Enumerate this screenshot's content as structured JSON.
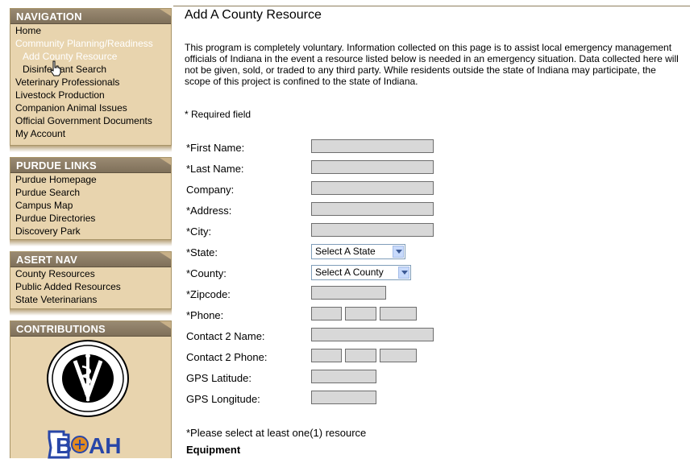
{
  "sidebar": {
    "navigation": {
      "title": "Navigation",
      "items": [
        {
          "label": "Home",
          "active": false,
          "sub": false
        },
        {
          "label": "Community Planning/Readiness",
          "active": true,
          "sub": false
        },
        {
          "label": "Add County Resource",
          "active": true,
          "sub": true
        },
        {
          "label": "Disinfectant Search",
          "active": false,
          "sub": true
        },
        {
          "label": "Veterinary Professionals",
          "active": false,
          "sub": false
        },
        {
          "label": "Livestock Production",
          "active": false,
          "sub": false
        },
        {
          "label": "Companion Animal Issues",
          "active": false,
          "sub": false
        },
        {
          "label": "Official Government Documents",
          "active": false,
          "sub": false
        },
        {
          "label": "My Account",
          "active": false,
          "sub": false
        }
      ]
    },
    "purdue_links": {
      "title": "Purdue Links",
      "items": [
        "Purdue Homepage",
        "Purdue Search",
        "Campus Map",
        "Purdue Directories",
        "Discovery Park"
      ]
    },
    "asert_nav": {
      "title": "ASERT Nav",
      "items": [
        "County Resources",
        "Public Added Resources",
        "State Veterinarians"
      ]
    },
    "contributions": {
      "title": "Contributions",
      "seal_text": "Veterinary Medicine Purdue",
      "boah_text": "BOAH"
    }
  },
  "main": {
    "title": "Add A County Resource",
    "intro": "This program is completely voluntary. Information collected on this page is to assist local emergency management officials of Indiana in the event a resource listed below is needed in an emergency situation. Data collected here will not be given, sold, or traded to any third party. While residents outside the state of Indiana may participate, the scope of this project is confined to the state of Indiana.",
    "required_note": "* Required field",
    "form": {
      "first_name": {
        "label": "*First Name:",
        "value": ""
      },
      "last_name": {
        "label": "*Last Name:",
        "value": ""
      },
      "company": {
        "label": "Company:",
        "value": ""
      },
      "address": {
        "label": "*Address:",
        "value": ""
      },
      "city": {
        "label": "*City:",
        "value": ""
      },
      "state": {
        "label": "*State:",
        "selected": "Select A State"
      },
      "county": {
        "label": "*County:",
        "selected": "Select A County"
      },
      "zipcode": {
        "label": "*Zipcode:",
        "value": ""
      },
      "phone": {
        "label": "*Phone:",
        "value": ""
      },
      "contact2_name": {
        "label": "Contact 2 Name:",
        "value": ""
      },
      "contact2_phone": {
        "label": "Contact 2 Phone:",
        "value": ""
      },
      "gps_latitude": {
        "label": "GPS Latitude:",
        "value": ""
      },
      "gps_longitude": {
        "label": "GPS Longitude:",
        "value": ""
      }
    },
    "resource_note": "*Please select at least one(1) resource",
    "equipment_heading": "Equipment"
  },
  "colors": {
    "sidebar_bg": "#e8d4ae",
    "panel_header": "#8a7b64",
    "input_bg": "#d8d8d8"
  }
}
